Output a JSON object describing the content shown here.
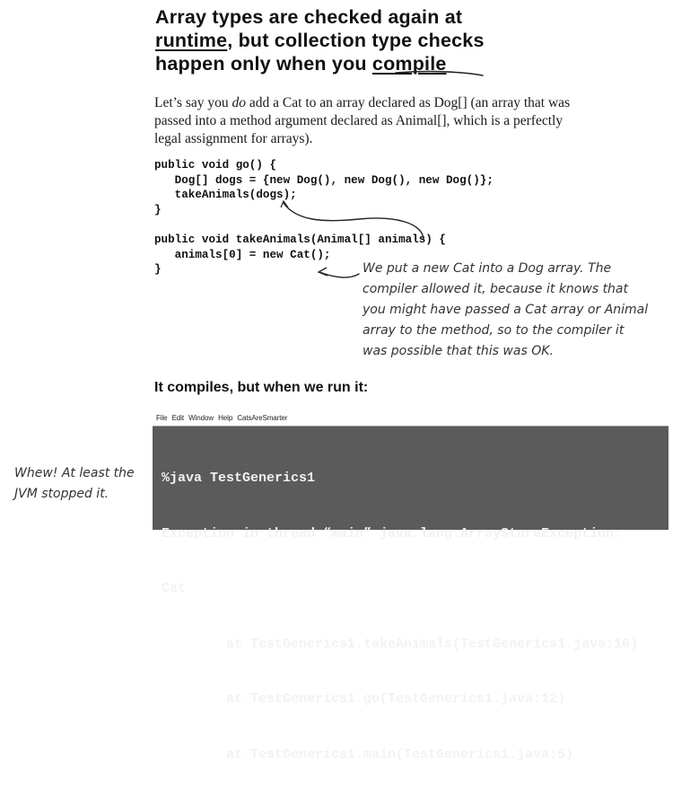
{
  "heading": {
    "line1": "Array types are checked again at",
    "line2_underlined": "runtime",
    "line2_rest": ", but collection type checks",
    "line3_prefix": "happen only when you ",
    "line3_underlined": "compile"
  },
  "intro": {
    "text_before": "Let’s say you ",
    "text_italic": "do",
    "text_after": " add a Cat to an array declared as Dog[] (an array that was passed into a method argument declared as Animal[], which is a perfectly legal assignment for arrays)."
  },
  "code": {
    "lines": [
      "public void go() {",
      "   Dog[] dogs = {new Dog(), new Dog(), new Dog()};",
      "   takeAnimals(dogs);",
      "}",
      "",
      "public void takeAnimals(Animal[] animals) {",
      "   animals[0] = new Cat();",
      "}"
    ]
  },
  "annotation": {
    "lines": [
      "We put a new Cat into a Dog array. The",
      "compiler allowed it, because it knows that",
      "you might have passed a Cat array or Animal",
      "array to the method, so to the compiler it",
      "was possible that this was OK."
    ]
  },
  "subheading": "It compiles, but when we run it:",
  "terminal": {
    "menu": [
      "File",
      "Edit",
      "Window",
      "Help",
      "CatsAreSmarter"
    ],
    "lines": [
      "%java TestGenerics1",
      "Exception in thread “main” java.lang.ArrayStoreException:",
      "Cat",
      "        at TestGenerics1.takeAnimals(TestGenerics1.java:16)",
      "        at TestGenerics1.go(TestGenerics1.java:12)",
      "        at TestGenerics1.main(TestGenerics1.java:5)"
    ],
    "background": "#5b5b5b"
  },
  "side_note": {
    "line1": "Whew! At least the",
    "line2": "JVM stopped it."
  }
}
